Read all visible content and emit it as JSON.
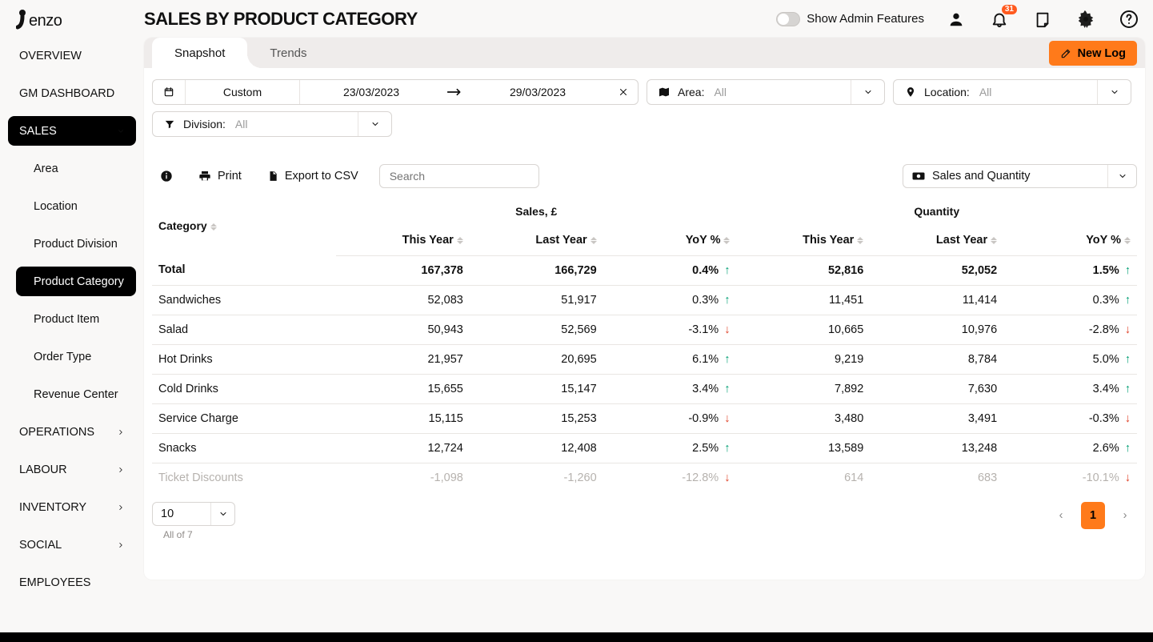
{
  "brand": "Tenzo",
  "header": {
    "title": "SALES BY PRODUCT CATEGORY",
    "admin_toggle_label": "Show Admin Features",
    "notification_count": "31"
  },
  "sidebar": {
    "items": [
      {
        "label": "OVERVIEW",
        "type": "top"
      },
      {
        "label": "GM DASHBOARD",
        "type": "top"
      },
      {
        "label": "SALES",
        "type": "top",
        "active": true,
        "expanded": true
      },
      {
        "label": "Area",
        "type": "sub"
      },
      {
        "label": "Location",
        "type": "sub"
      },
      {
        "label": "Product Division",
        "type": "sub"
      },
      {
        "label": "Product Category",
        "type": "sub",
        "active": true
      },
      {
        "label": "Product Item",
        "type": "sub"
      },
      {
        "label": "Order Type",
        "type": "sub"
      },
      {
        "label": "Revenue Center",
        "type": "sub"
      },
      {
        "label": "OPERATIONS",
        "type": "top",
        "chev": true
      },
      {
        "label": "LABOUR",
        "type": "top",
        "chev": true
      },
      {
        "label": "INVENTORY",
        "type": "top",
        "chev": true
      },
      {
        "label": "SOCIAL",
        "type": "top",
        "chev": true
      },
      {
        "label": "EMPLOYEES",
        "type": "top"
      }
    ]
  },
  "tabs": {
    "snapshot": "Snapshot",
    "trends": "Trends"
  },
  "new_log_label": "New Log",
  "filters": {
    "date_mode": "Custom",
    "date_from": "23/03/2023",
    "date_to": "29/03/2023",
    "area_label": "Area:",
    "area_value": "All",
    "location_label": "Location:",
    "location_value": "All",
    "division_label": "Division:",
    "division_value": "All"
  },
  "toolbar": {
    "print_label": "Print",
    "export_label": "Export to CSV",
    "search_placeholder": "Search",
    "metric_label": "Sales and Quantity"
  },
  "table": {
    "super_sales": "Sales, £",
    "super_qty": "Quantity",
    "col_category": "Category",
    "col_this_year": "This Year",
    "col_last_year": "Last Year",
    "col_yoy": "YoY %",
    "rows": [
      {
        "category": "Total",
        "s_ty": "167,378",
        "s_ly": "166,729",
        "s_yoy": "0.4%",
        "s_dir": "up",
        "q_ty": "52,816",
        "q_ly": "52,052",
        "q_yoy": "1.5%",
        "q_dir": "up",
        "total": true
      },
      {
        "category": "Sandwiches",
        "s_ty": "52,083",
        "s_ly": "51,917",
        "s_yoy": "0.3%",
        "s_dir": "up",
        "q_ty": "11,451",
        "q_ly": "11,414",
        "q_yoy": "0.3%",
        "q_dir": "up"
      },
      {
        "category": "Salad",
        "s_ty": "50,943",
        "s_ly": "52,569",
        "s_yoy": "-3.1%",
        "s_dir": "down",
        "q_ty": "10,665",
        "q_ly": "10,976",
        "q_yoy": "-2.8%",
        "q_dir": "down"
      },
      {
        "category": "Hot Drinks",
        "s_ty": "21,957",
        "s_ly": "20,695",
        "s_yoy": "6.1%",
        "s_dir": "up",
        "q_ty": "9,219",
        "q_ly": "8,784",
        "q_yoy": "5.0%",
        "q_dir": "up"
      },
      {
        "category": "Cold Drinks",
        "s_ty": "15,655",
        "s_ly": "15,147",
        "s_yoy": "3.4%",
        "s_dir": "up",
        "q_ty": "7,892",
        "q_ly": "7,630",
        "q_yoy": "3.4%",
        "q_dir": "up"
      },
      {
        "category": "Service Charge",
        "s_ty": "15,115",
        "s_ly": "15,253",
        "s_yoy": "-0.9%",
        "s_dir": "down",
        "q_ty": "3,480",
        "q_ly": "3,491",
        "q_yoy": "-0.3%",
        "q_dir": "down"
      },
      {
        "category": "Snacks",
        "s_ty": "12,724",
        "s_ly": "12,408",
        "s_yoy": "2.5%",
        "s_dir": "up",
        "q_ty": "13,589",
        "q_ly": "13,248",
        "q_yoy": "2.6%",
        "q_dir": "up"
      },
      {
        "category": "Ticket Discounts",
        "s_ty": "-1,098",
        "s_ly": "-1,260",
        "s_yoy": "-12.8%",
        "s_dir": "down",
        "q_ty": "614",
        "q_ly": "683",
        "q_yoy": "-10.1%",
        "q_dir": "down",
        "muted": true
      }
    ]
  },
  "pager": {
    "page_size": "10",
    "count_label": "All of 7",
    "current_page": "1"
  }
}
